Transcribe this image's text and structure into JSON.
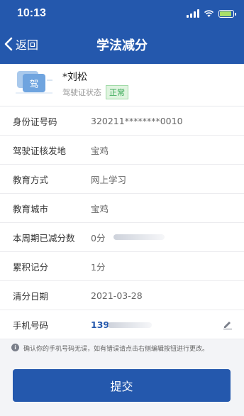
{
  "status_bar": {
    "time": "10:13"
  },
  "nav": {
    "back_label": "返回",
    "title": "学法减分"
  },
  "profile": {
    "name": "*刘松",
    "license_status_label": "驾驶证状态",
    "status_badge": "正常",
    "card_icon_char": "驾"
  },
  "rows": [
    {
      "label": "身份证号码",
      "value": "320211********0010"
    },
    {
      "label": "驾驶证核发地",
      "value": "宝鸡"
    },
    {
      "label": "教育方式",
      "value": "网上学习"
    },
    {
      "label": "教育城市",
      "value": "宝鸡"
    },
    {
      "label": "本周期已减分数",
      "value": "0分"
    },
    {
      "label": "累积记分",
      "value": "1分"
    },
    {
      "label": "清分日期",
      "value": "2021-03-28"
    },
    {
      "label": "手机号码",
      "value": "139"
    }
  ],
  "notice": "确认你的手机号码无误，如有错误请点击右侧编辑按钮进行更改。",
  "submit_label": "提交",
  "colors": {
    "primary": "#2458ad",
    "badge_green": "#2fa44f"
  }
}
